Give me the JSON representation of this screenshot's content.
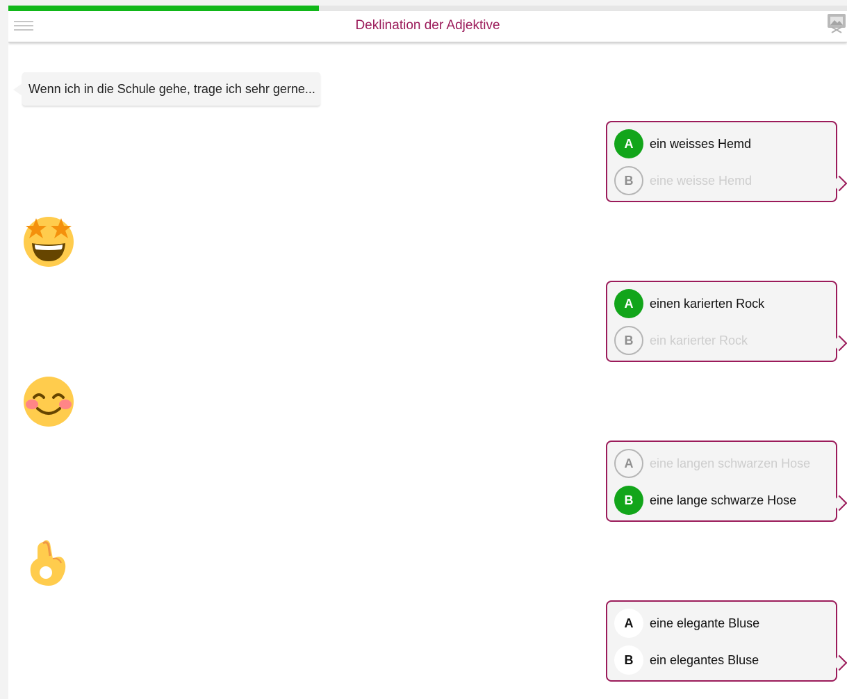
{
  "header": {
    "title": "Deklination der Adjektive",
    "progress_percent": 37,
    "progress_color": "#12b81a",
    "title_color": "#9b1b5a",
    "menu_icon": "hamburger-menu-icon",
    "corner_icon": "close-icon"
  },
  "prompt": {
    "text": "Wenn ich in die Schule gehe, trage ich sehr gerne..."
  },
  "questions": [
    {
      "options": [
        {
          "letter": "A",
          "text": "ein weisses Hemd",
          "state": "correct"
        },
        {
          "letter": "B",
          "text": "eine weisse Hemd",
          "state": "wrong"
        }
      ],
      "reaction_emoji": "star-struck-emoji"
    },
    {
      "options": [
        {
          "letter": "A",
          "text": "einen karierten Rock",
          "state": "correct"
        },
        {
          "letter": "B",
          "text": "ein karierter Rock",
          "state": "wrong"
        }
      ],
      "reaction_emoji": "smiling-face-emoji"
    },
    {
      "options": [
        {
          "letter": "A",
          "text": "eine langen schwarzen Hose",
          "state": "wrong"
        },
        {
          "letter": "B",
          "text": "eine lange schwarze Hose",
          "state": "correct"
        }
      ],
      "reaction_emoji": "ok-hand-emoji"
    },
    {
      "options": [
        {
          "letter": "A",
          "text": "eine elegante Bluse",
          "state": "neutral"
        },
        {
          "letter": "B",
          "text": "ein elegantes Bluse",
          "state": "neutral"
        }
      ]
    }
  ]
}
